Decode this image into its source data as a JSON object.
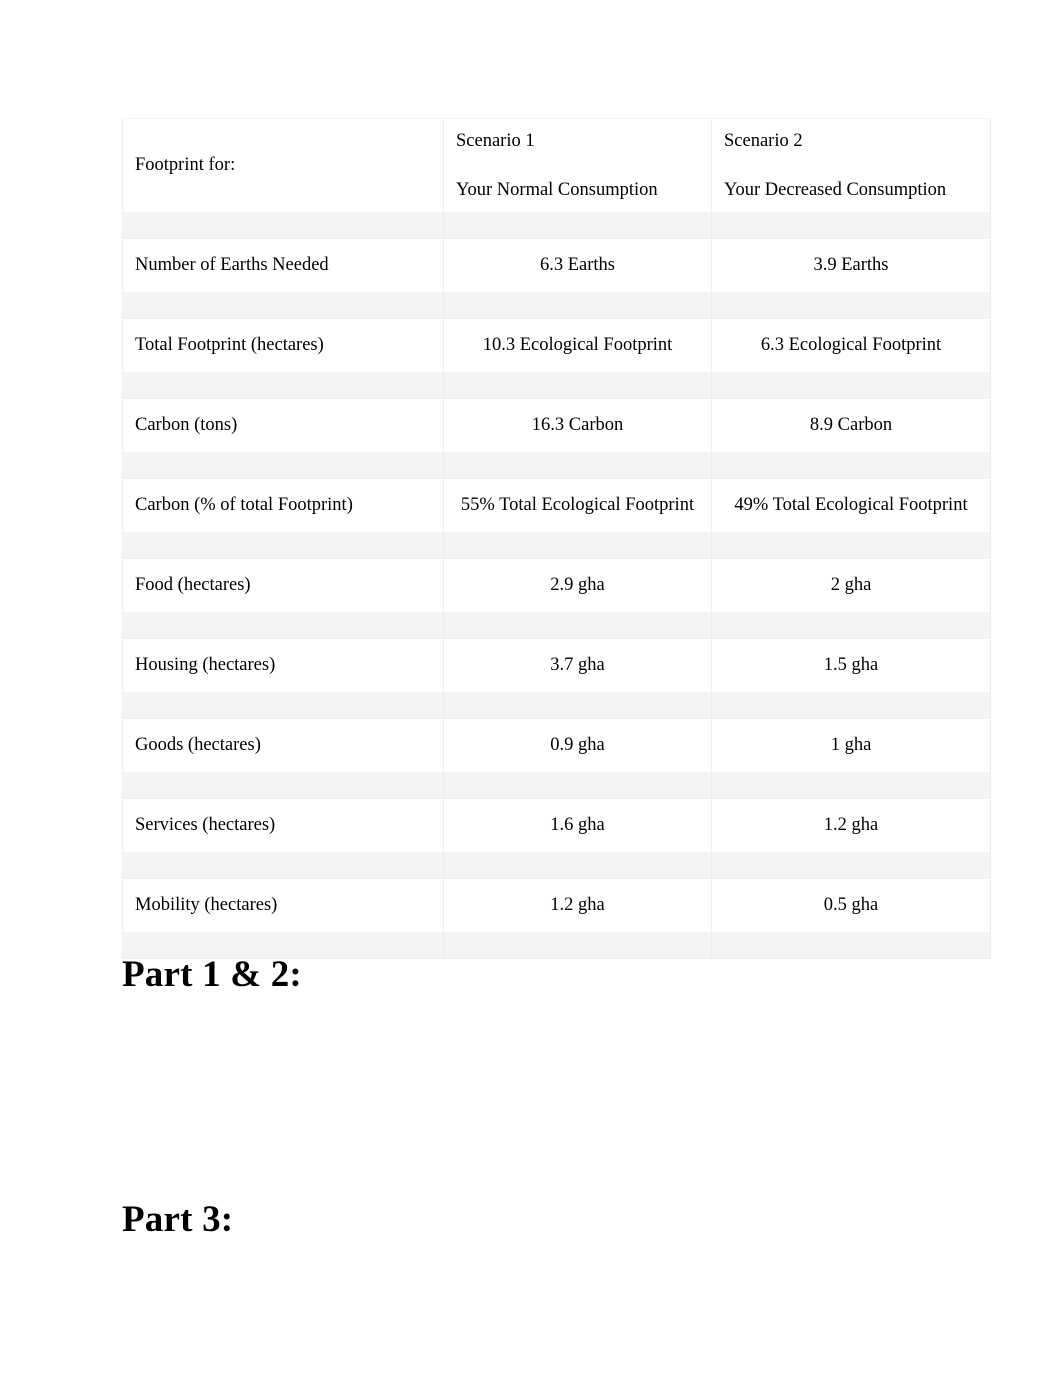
{
  "document": {
    "page_background": "#ffffff",
    "text_color": "#000000"
  },
  "table": {
    "name": "ecological-footprint-comparison-table",
    "header": {
      "label_column": "Footprint for:",
      "scenario_1": {
        "title": "Scenario 1",
        "subtitle": "Your Normal Consumption"
      },
      "scenario_2": {
        "title": "Scenario 2",
        "subtitle": "Your Decreased Consumption"
      }
    },
    "rows": [
      {
        "label": "Number of Earths Needed",
        "scenario_1": "6.3 Earths",
        "scenario_2": "3.9 Earths"
      },
      {
        "label": "Total Footprint (hectares)",
        "scenario_1": "10.3 Ecological Footprint",
        "scenario_2": "6.3 Ecological Footprint"
      },
      {
        "label": "Carbon (tons)",
        "scenario_1": "16.3 Carbon",
        "scenario_2": "8.9 Carbon"
      },
      {
        "label": "Carbon (% of total Footprint)",
        "scenario_1": "55% Total Ecological Footprint",
        "scenario_2": "49% Total Ecological Footprint"
      },
      {
        "label": "Food (hectares)",
        "scenario_1": "2.9 gha",
        "scenario_2": "2 gha"
      },
      {
        "label": "Housing (hectares)",
        "scenario_1": "3.7 gha",
        "scenario_2": "1.5 gha"
      },
      {
        "label": "Goods (hectares)",
        "scenario_1": "0.9 gha",
        "scenario_2": "1 gha"
      },
      {
        "label": "Services (hectares)",
        "scenario_1": "1.6 gha",
        "scenario_2": "1.2 gha"
      },
      {
        "label": "Mobility (hectares)",
        "scenario_1": "1.2 gha",
        "scenario_2": "0.5 gha"
      }
    ]
  },
  "headings": {
    "part_1_2": "Part 1 & 2:",
    "part_3": "Part 3:"
  }
}
